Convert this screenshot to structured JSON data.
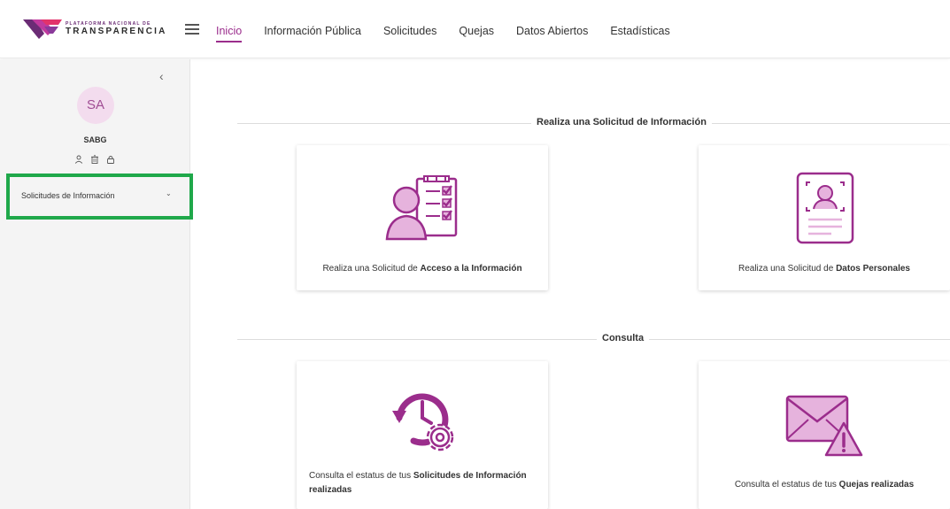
{
  "header": {
    "logo_small": "PLATAFORMA NACIONAL DE",
    "logo_big": "TRANSPARENCIA",
    "nav": [
      {
        "label": "Inicio",
        "active": true
      },
      {
        "label": "Información Pública"
      },
      {
        "label": "Solicitudes"
      },
      {
        "label": "Quejas"
      },
      {
        "label": "Datos Abiertos"
      },
      {
        "label": "Estadísticas"
      }
    ]
  },
  "sidebar": {
    "collapse": "‹",
    "avatar_initials": "SA",
    "username": "SABG",
    "menu_item": "Solicitudes de Información",
    "menu_chevron": "⌄"
  },
  "sections": {
    "solicitud_title": "Realiza una Solicitud de Información",
    "consulta_title": "Consulta"
  },
  "cards": {
    "acceso": {
      "prefix": "Realiza una Solicitud de ",
      "bold": "Acceso a la Información"
    },
    "datos": {
      "prefix": "Realiza una Solicitud de ",
      "bold": "Datos Personales"
    },
    "estatus_solicitudes": {
      "prefix": "Consulta el estatus de tus ",
      "bold": "Solicitudes de Información",
      "bold2": "realizadas"
    },
    "estatus_quejas": {
      "prefix": "Consulta el estatus de tus ",
      "bold": "Quejas realizadas"
    }
  },
  "colors": {
    "accent": "#9b2d8c",
    "icon_fill": "#e6b3dd",
    "highlight": "#1fa84a"
  }
}
